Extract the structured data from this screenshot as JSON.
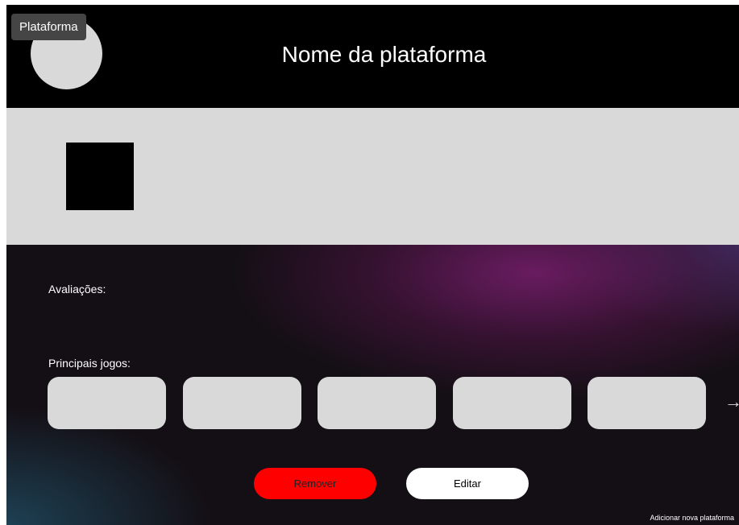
{
  "frame": {
    "tag_label": "Plataforma"
  },
  "header": {
    "platform_name": "Nome da plataforma"
  },
  "details": {
    "ratings_label": "Avaliações:",
    "top_games_label": "Principais jogos:",
    "games": [
      "",
      "",
      "",
      "",
      ""
    ],
    "next_icon": "arrow-right-icon"
  },
  "actions": {
    "remove_label": "Remover",
    "edit_label": "Editar",
    "add_new_label": "Adicionar nova plataforma"
  },
  "colors": {
    "header_bg": "#000000",
    "banner_bg": "#d9d9d9",
    "placeholder": "#d9d9d9",
    "remove_button": "#ff0000",
    "edit_button": "#ffffff",
    "accent_gradient": "#781e6e"
  }
}
